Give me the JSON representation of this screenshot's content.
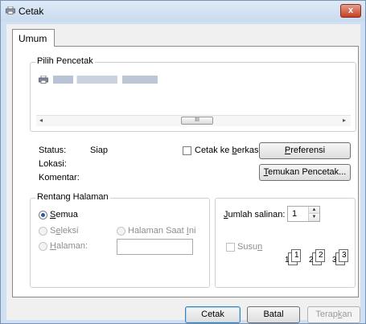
{
  "window": {
    "title": "Cetak",
    "close_label": "x"
  },
  "tab": {
    "label": "Umum"
  },
  "printer_group": {
    "title": "Pilih Pencetak",
    "printer_name_text": "",
    "scrollbar": {
      "left_arrow": "◂",
      "right_arrow": "▸",
      "thumb_grip": "III"
    }
  },
  "status": {
    "status_label": "Status:",
    "status_value": "Siap",
    "location_label": "Lokasi:",
    "location_value": "",
    "comment_label": "Komentar:",
    "comment_value": ""
  },
  "print_to_file": {
    "label_pre": "Cetak ke ",
    "label_accel": "b",
    "label_post": "erkas",
    "checked": false
  },
  "preferences_button": {
    "accel": "P",
    "rest": "referensi"
  },
  "find_printer_button": {
    "accel": "T",
    "rest": "emukan Pencetak..."
  },
  "page_range": {
    "title": "Rentang Halaman",
    "all": {
      "accel": "S",
      "rest": "emua",
      "checked": true
    },
    "selection": {
      "pre": "S",
      "accel": "e",
      "rest": "leksi"
    },
    "current_page": {
      "pre": "Halaman Saat ",
      "accel": "I",
      "rest": "ni"
    },
    "pages": {
      "accel": "H",
      "rest": "alaman:",
      "value": ""
    }
  },
  "copies": {
    "label_accel": "J",
    "label_rest": "umlah salinan:",
    "value": "1",
    "collate_pre": "Susu",
    "collate_accel": "n",
    "collate_checked": false,
    "collate_pages": [
      "1",
      "1",
      "2",
      "2",
      "3",
      "3"
    ]
  },
  "buttons": {
    "print": "Cetak",
    "cancel": "Batal",
    "apply_pre": "Terap",
    "apply_accel": "k",
    "apply_rest": "an"
  }
}
